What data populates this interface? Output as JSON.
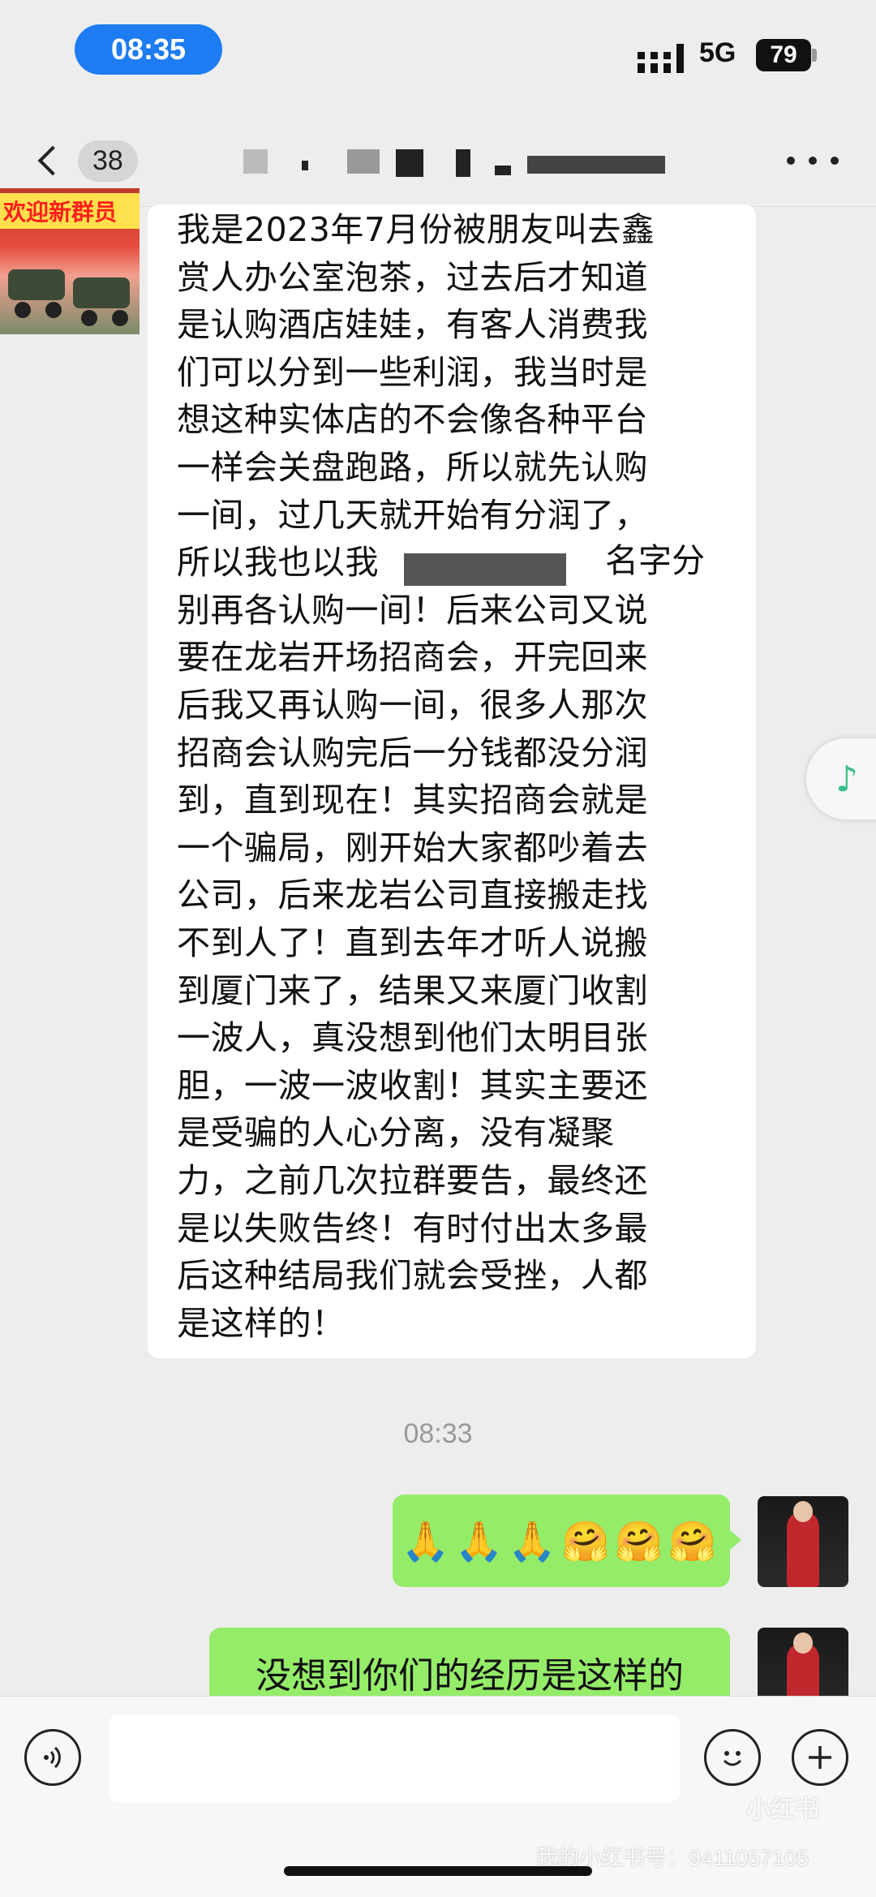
{
  "status_bar": {
    "time": "08:35",
    "network": "5G",
    "battery": "79"
  },
  "nav": {
    "unread_count": "38"
  },
  "banner": {
    "text": "欢迎新群员"
  },
  "incoming_message": {
    "lines": [
      "我是2023年7月份被朋友叫去鑫",
      "赏人办公室泡茶，过去后才知道",
      "是认购酒店娃娃，有客人消费我",
      "们可以分到一些利润，我当时是",
      "想这种实体店的不会像各种平台",
      "一样会关盘跑路，所以就先认购",
      "一间，过几天就开始有分润了，",
      "所以我也以我",
      "别再各认购一间！后来公司又说",
      "要在龙岩开场招商会，开完回来",
      "后我又再认购一间，很多人那次",
      "招商会认购完后一分钱都没分润",
      "到，直到现在！其实招商会就是",
      "一个骗局，刚开始大家都吵着去",
      "公司，后来龙岩公司直接搬走找",
      "不到人了！直到去年才听人说搬",
      "到厦门来了，结果又来厦门收割",
      "一波人，真没想到他们太明目张",
      "胆，一波一波收割！其实主要还",
      "是受骗的人心分离，没有凝聚",
      "力，之前几次拉群要告，最终还",
      "是以失败告终！有时付出太多最",
      "后这种结局我们就会受挫，人都",
      "是这样的！"
    ],
    "partial_after_redaction": "名字分"
  },
  "timestamp": "08:33",
  "outgoing_messages": [
    {
      "text": "🙏🙏🙏🤗🤗🤗"
    },
    {
      "text": "没想到你们的经历是这样的"
    }
  ],
  "input_bar": {
    "placeholder": ""
  },
  "watermark": {
    "logo": "小红书",
    "id": "我的小红书号：9411057105"
  },
  "icons": {
    "back": "chevron-left-icon",
    "more": "more-icon",
    "voice": "voice-icon",
    "emoji": "emoji-icon",
    "add": "add-icon",
    "music": "music-note-icon"
  },
  "colors": {
    "time_pill": "#1e7cf2",
    "outgoing_bubble": "#95ec69",
    "incoming_bubble": "#ffffff",
    "background": "#ededed"
  }
}
